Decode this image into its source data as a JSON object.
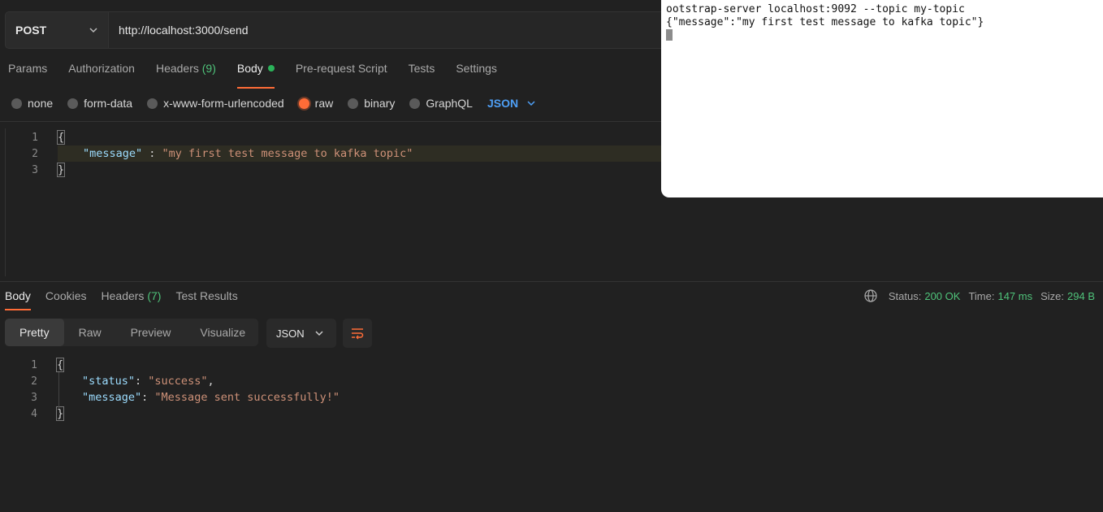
{
  "request": {
    "method": "POST",
    "url": "http://localhost:3000/send",
    "tabs": [
      {
        "label": "Params"
      },
      {
        "label": "Authorization"
      },
      {
        "label": "Headers",
        "count": "(9)"
      },
      {
        "label": "Body"
      },
      {
        "label": "Pre-request Script"
      },
      {
        "label": "Tests"
      },
      {
        "label": "Settings"
      }
    ],
    "body_types": [
      "none",
      "form-data",
      "x-www-form-urlencoded",
      "raw",
      "binary",
      "GraphQL"
    ],
    "body_format": "JSON",
    "editor": {
      "line_numbers": [
        "1",
        "2",
        "3"
      ],
      "open_brace": "{",
      "key": "\"message\"",
      "separator": " : ",
      "value": "\"my first test message to kafka topic\"",
      "close_brace": "}"
    }
  },
  "response": {
    "tabs": [
      {
        "label": "Body"
      },
      {
        "label": "Cookies"
      },
      {
        "label": "Headers",
        "count": "(7)"
      },
      {
        "label": "Test Results"
      }
    ],
    "status_label": "Status:",
    "status_value": "200 OK",
    "time_label": "Time:",
    "time_value": "147 ms",
    "size_label": "Size:",
    "size_value": "294 B",
    "view_modes": [
      "Pretty",
      "Raw",
      "Preview",
      "Visualize"
    ],
    "format": "JSON",
    "body": {
      "line_numbers": [
        "1",
        "2",
        "3",
        "4"
      ],
      "open_brace": "{",
      "k1": "\"status\"",
      "v1": "\"success\"",
      "k2": "\"message\"",
      "v2": "\"Message sent successfully!\"",
      "close_brace": "}"
    }
  },
  "terminal": {
    "line1": "ootstrap-server localhost:9092 --topic my-topic",
    "line2": "{\"message\":\"my first test message to kafka topic\"}"
  },
  "colors": {
    "accent": "#ff6c37",
    "success": "#4fc37a",
    "json_blue": "#4e9ff5"
  }
}
